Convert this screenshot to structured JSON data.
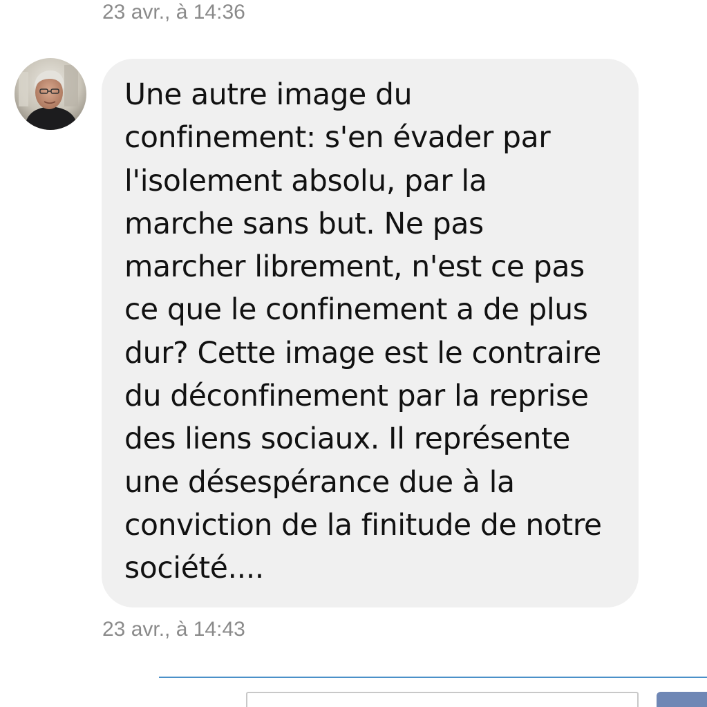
{
  "messages": [
    {
      "timestamp": "23 avr., à 14:36"
    },
    {
      "text": "Une autre image du\nconfinement: s'en évader par\nl'isolement absolu, par la\nmarche sans but. Ne pas\nmarcher librement, n'est ce pas\nce que le confinement a de plus\ndur? Cette image est le contraire\ndu déconfinement par la reprise\ndes liens sociaux. Il représente\nune désespérance due à la\nconviction de la finitude de notre\nsociété....",
      "timestamp": "23 avr., à 14:43"
    }
  ],
  "colors": {
    "bubble_background": "#f0f0f0",
    "timestamp_text": "#8a8a8a",
    "divider_accent": "#4a90c8",
    "send_button": "#6f87b5"
  },
  "icons": {
    "avatar": "user-avatar-photo"
  }
}
